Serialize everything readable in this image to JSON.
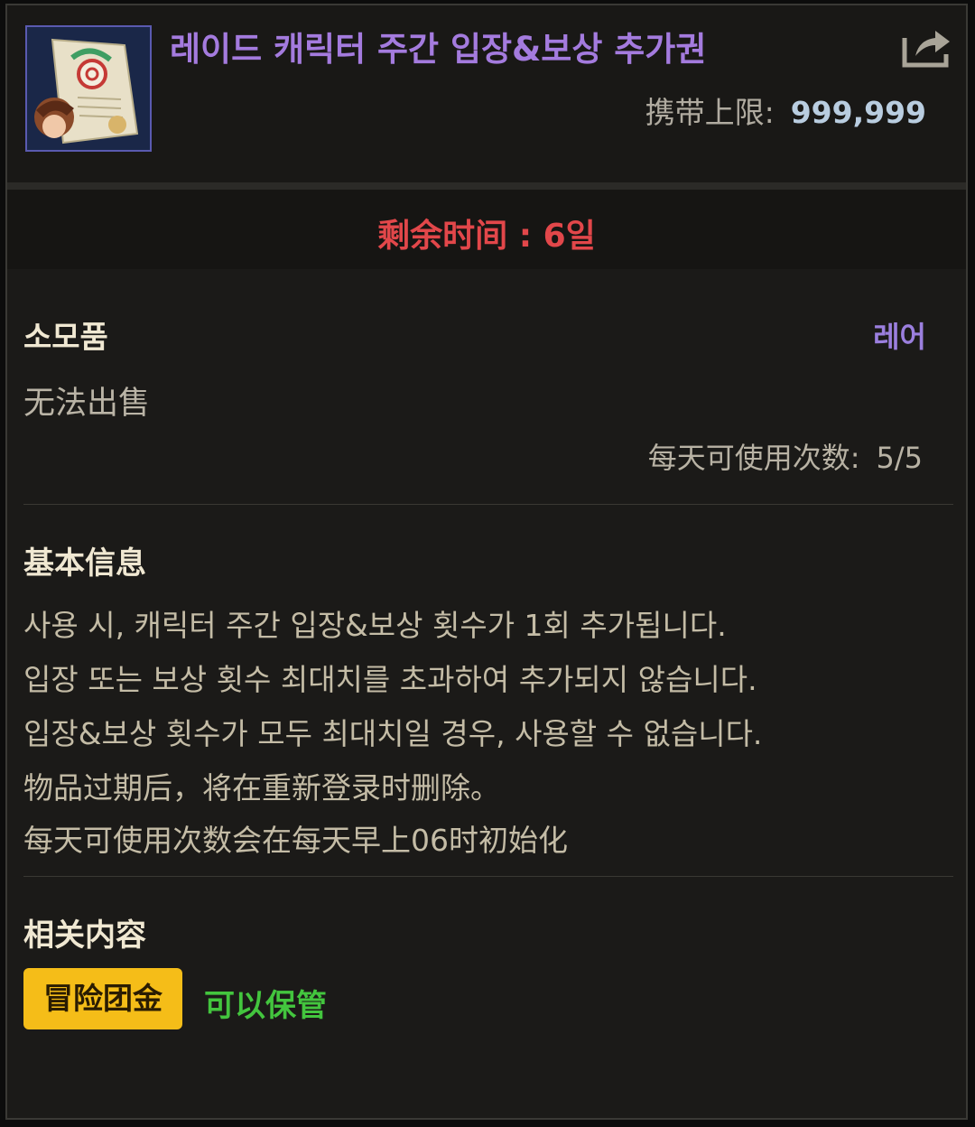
{
  "item": {
    "title": "레이드 캐릭터 주간 입장&보상 추가권",
    "icon": "raid-ticket-scroll-icon",
    "carry_label": "携带上限:",
    "carry_value": "999,999"
  },
  "remaining": {
    "text": "剩余时间 : 6일"
  },
  "category": {
    "type": "소모품",
    "rarity": "레어",
    "sell_status": "无法出售",
    "daily_uses_label": "每天可使用次数:",
    "daily_uses_value": "5/5"
  },
  "basic_info": {
    "title": "基本信息",
    "lines": [
      "사용 시, 캐릭터 주간 입장&보상 횟수가 1회 추가됩니다.",
      "입장 또는 보상 횟수 최대치를 초과하여 추가되지 않습니다.",
      "입장&보상 횟수가 모두 최대치일 경우, 사용할 수 없습니다.",
      "物品过期后，将在重新登录时删除。",
      "每天可使用次数会在每天早上06时初始化"
    ]
  },
  "related": {
    "title": "相关内容",
    "tag_label": "冒险团金",
    "storable_text": "可以保管"
  },
  "colors": {
    "title_purple": "#a47bde",
    "remaining_red": "#e2474a",
    "rarity_purple": "#9b7fde",
    "tag_gold": "#f5bd18",
    "storable_green": "#43c53e"
  }
}
